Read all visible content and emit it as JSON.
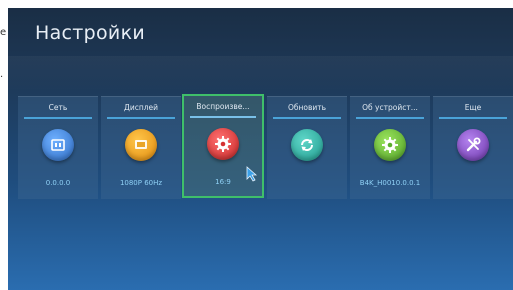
{
  "left_fragment": [
    "е",
    "."
  ],
  "header": {
    "title": "Настройки"
  },
  "tiles": [
    {
      "label": "Сеть",
      "value": "0.0.0.0",
      "icon": "network-icon",
      "color": "#3d7fd6"
    },
    {
      "label": "Дисплей",
      "value": "1080P 60Hz",
      "icon": "display-icon",
      "color": "#f2a21a"
    },
    {
      "label": "Воспроизве...",
      "value": "16:9",
      "icon": "playback-gear-icon",
      "color": "#e23a3a"
    },
    {
      "label": "Обновить",
      "value": "",
      "icon": "refresh-icon",
      "color": "#2bb3a6"
    },
    {
      "label": "Об устройст...",
      "value": "B4K_H0010.0.0.1",
      "icon": "about-gear-icon",
      "color": "#6abf3b"
    },
    {
      "label": "Еще",
      "value": "",
      "icon": "tools-icon",
      "color": "#8a4ec2"
    }
  ],
  "colors": {
    "selection": "#3fbf6a",
    "accent": "#4aa3d8"
  }
}
